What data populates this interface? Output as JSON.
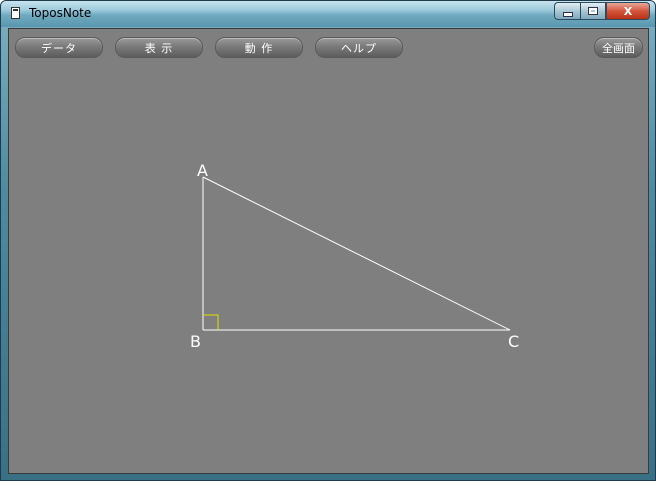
{
  "window": {
    "title": "ToposNote",
    "controls": {
      "minimize": "minimize",
      "maximize": "maximize",
      "close": "X"
    }
  },
  "toolbar": {
    "data_label": "データ",
    "view_label": "表 示",
    "action_label": "動 作",
    "help_label": "ヘルプ",
    "fullscreen_label": "全画面"
  },
  "figure": {
    "points": {
      "A": "A",
      "B": "B",
      "C": "C"
    },
    "line_color": "#ffffff",
    "right_angle_color": "#e0e000",
    "background": "#7f7f7f"
  }
}
